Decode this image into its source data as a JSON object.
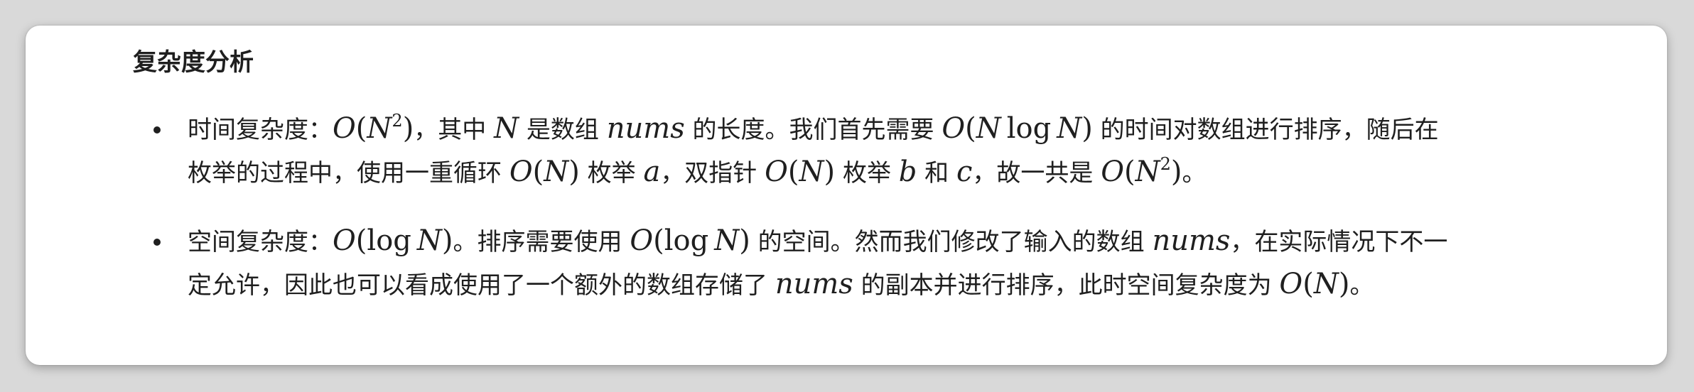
{
  "heading": "复杂度分析",
  "items": [
    {
      "lines": [
        [
          {
            "t": "text",
            "v": "时间复杂度："
          },
          {
            "t": "math",
            "v": "O(N²)"
          },
          {
            "t": "text",
            "v": "，其中 "
          },
          {
            "t": "math",
            "v": "N"
          },
          {
            "t": "text",
            "v": " 是数组 "
          },
          {
            "t": "math",
            "v": "nums"
          },
          {
            "t": "text",
            "v": " 的长度。我们首先需要 "
          },
          {
            "t": "math",
            "v": "O(N log N)"
          },
          {
            "t": "text",
            "v": " 的时间对数组进行排序，随后在"
          }
        ],
        [
          {
            "t": "text",
            "v": "枚举的过程中，使用一重循环 "
          },
          {
            "t": "math",
            "v": "O(N)"
          },
          {
            "t": "text",
            "v": " 枚举 "
          },
          {
            "t": "math",
            "v": "a"
          },
          {
            "t": "text",
            "v": "，双指针 "
          },
          {
            "t": "math",
            "v": "O(N)"
          },
          {
            "t": "text",
            "v": " 枚举 "
          },
          {
            "t": "math",
            "v": "b"
          },
          {
            "t": "text",
            "v": " 和 "
          },
          {
            "t": "math",
            "v": "c"
          },
          {
            "t": "text",
            "v": "，故一共是 "
          },
          {
            "t": "math",
            "v": "O(N²)"
          },
          {
            "t": "text",
            "v": "。"
          }
        ]
      ]
    },
    {
      "lines": [
        [
          {
            "t": "text",
            "v": "空间复杂度："
          },
          {
            "t": "math",
            "v": "O(log N)"
          },
          {
            "t": "text",
            "v": "。排序需要使用 "
          },
          {
            "t": "math",
            "v": "O(log N)"
          },
          {
            "t": "text",
            "v": " 的空间。然而我们修改了输入的数组 "
          },
          {
            "t": "math",
            "v": "nums"
          },
          {
            "t": "text",
            "v": "，在实际情况下不一"
          }
        ],
        [
          {
            "t": "text",
            "v": "定允许，因此也可以看成使用了一个额外的数组存储了 "
          },
          {
            "t": "math",
            "v": "nums"
          },
          {
            "t": "text",
            "v": " 的副本并进行排序，此时空间复杂度为 "
          },
          {
            "t": "math",
            "v": "O(N)"
          },
          {
            "t": "text",
            "v": "。"
          }
        ]
      ]
    }
  ]
}
